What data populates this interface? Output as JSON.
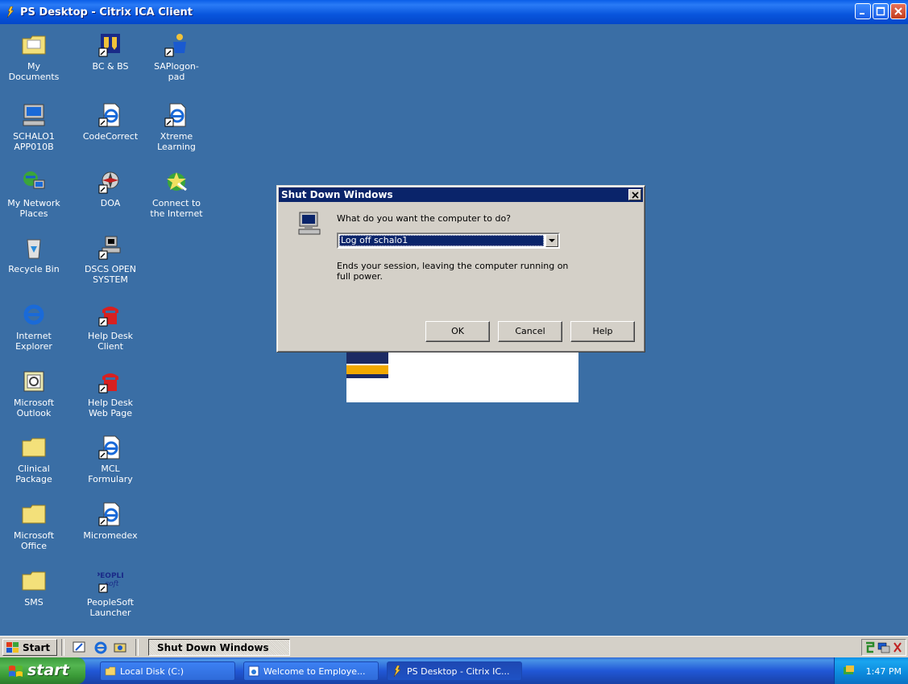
{
  "window": {
    "title": "PS Desktop - Citrix ICA Client"
  },
  "desktop_icons": [
    {
      "label": "My Documents",
      "icon": "my-documents-icon"
    },
    {
      "label": "BC & BS",
      "icon": "bc-bs-shortcut-icon"
    },
    {
      "label": "SAPlogon-pad",
      "icon": "saplogon-shortcut-icon"
    },
    {
      "label": "SCHALO1\nAPP010B",
      "icon": "computer-icon"
    },
    {
      "label": "CodeCorrect",
      "icon": "ie-shortcut-icon"
    },
    {
      "label": "Xtreme\nLearning",
      "icon": "ie-shortcut-icon"
    },
    {
      "label": "My Network\nPlaces",
      "icon": "network-places-icon"
    },
    {
      "label": "DOA",
      "icon": "compass-shortcut-icon"
    },
    {
      "label": "Connect to\nthe Internet",
      "icon": "connect-internet-icon"
    },
    {
      "label": "Recycle Bin",
      "icon": "recycle-bin-icon"
    },
    {
      "label": "DSCS OPEN\nSYSTEM",
      "icon": "terminal-shortcut-icon"
    },
    {
      "label": "Internet\nExplorer",
      "icon": "internet-explorer-icon"
    },
    {
      "label": "Help Desk\nClient",
      "icon": "telephone-shortcut-icon"
    },
    {
      "label": "Microsoft\nOutlook",
      "icon": "outlook-icon"
    },
    {
      "label": "Help Desk\nWeb Page",
      "icon": "telephone-shortcut-icon"
    },
    {
      "label": "Clinical\nPackage",
      "icon": "folder-icon"
    },
    {
      "label": "MCL Formulary",
      "icon": "ie-shortcut-icon"
    },
    {
      "label": "Microsoft\nOffice",
      "icon": "folder-icon"
    },
    {
      "label": "Micromedex",
      "icon": "ie-shortcut-icon"
    },
    {
      "label": "SMS",
      "icon": "folder-icon"
    },
    {
      "label": "PeopleSoft\nLauncher",
      "icon": "peoplesoft-shortcut-icon"
    }
  ],
  "dialog": {
    "title": "Shut Down Windows",
    "prompt": "What do you want the computer to do?",
    "selected_option": "Log off schalo1",
    "description": "Ends your session, leaving the computer running on full power.",
    "buttons": {
      "ok": "OK",
      "cancel": "Cancel",
      "help": "Help"
    }
  },
  "citrix_taskbar": {
    "start_label": "Start",
    "task_label": "Shut Down Windows"
  },
  "xp_taskbar": {
    "start_label": "start",
    "tasks": [
      {
        "label": "Local Disk (C:)",
        "icon": "drive-folder-icon"
      },
      {
        "label": "Welcome to Employe...",
        "icon": "browser-window-icon"
      },
      {
        "label": "PS Desktop - Citrix IC...",
        "icon": "citrix-icon"
      }
    ],
    "clock": "1:47 PM"
  },
  "colors": {
    "desktop": "#3a6ea5",
    "dialog_face": "#d4d0c8",
    "classic_title": "#0a246a",
    "xp_blue": "#2157d7",
    "xp_start_green": "#3a9a37"
  }
}
